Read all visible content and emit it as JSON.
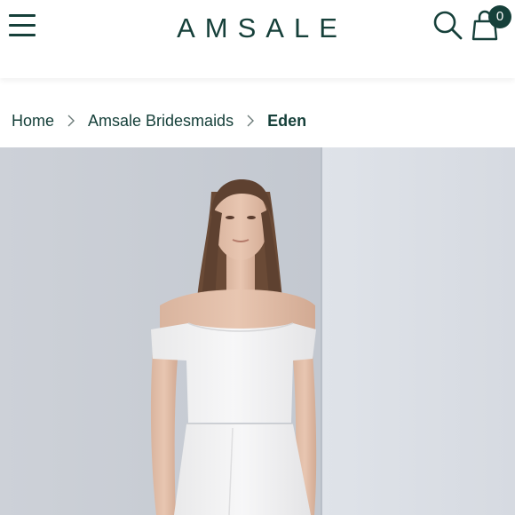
{
  "header": {
    "brand": "AMSALE",
    "bag_count": "0",
    "icons": {
      "menu": "hamburger-menu-icon",
      "search": "search-icon",
      "bag": "shopping-bag-icon"
    }
  },
  "breadcrumb": {
    "items": [
      "Home",
      "Amsale Bridesmaids",
      "Eden"
    ]
  },
  "colors": {
    "brand": "#16403a",
    "background": "#ffffff",
    "photo_backdrop": "#c9ced6"
  }
}
